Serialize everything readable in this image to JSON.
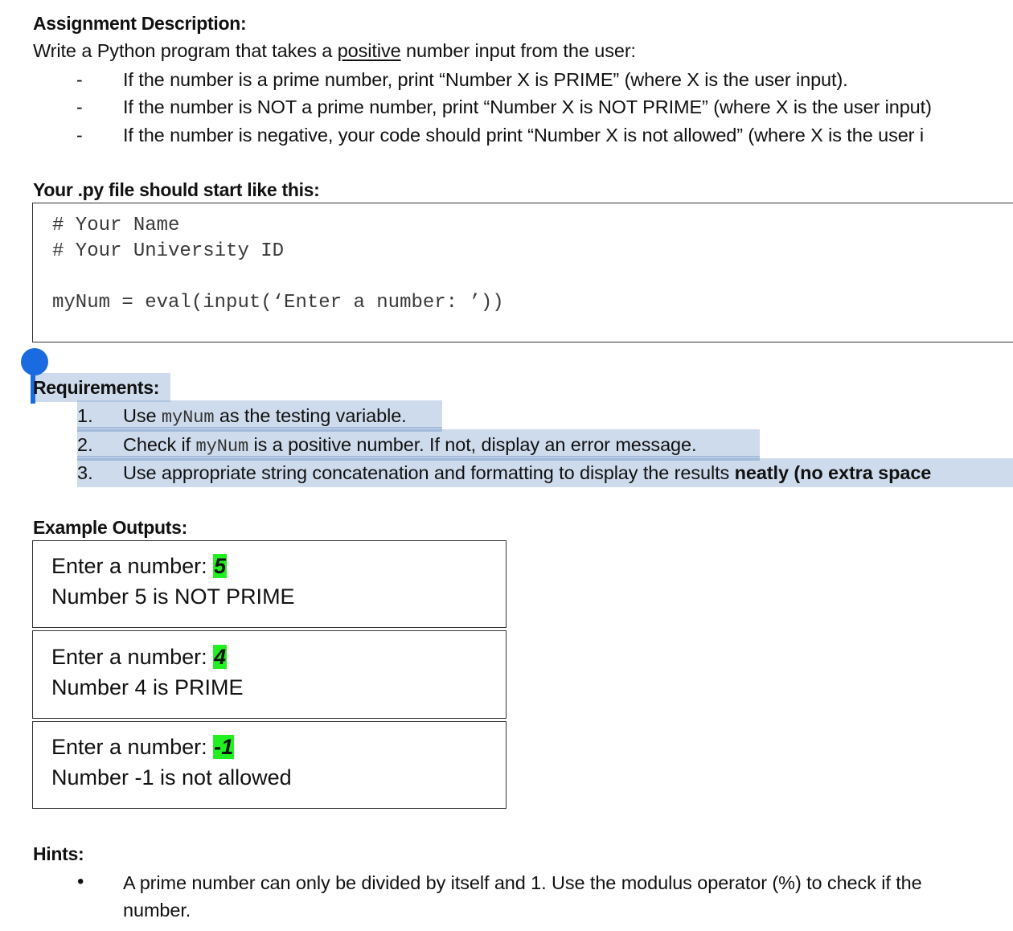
{
  "assignment": {
    "heading": "Assignment Description:",
    "intro_before": "Write a Python program that takes a ",
    "intro_underlined": "positive",
    "intro_after": " number input from the user:",
    "bullets": [
      {
        "marker": "-",
        "text": "If the number is a prime number, print “Number X is PRIME” (where X is the user input)."
      },
      {
        "marker": "-",
        "text": "If the number is NOT a prime number, print “Number X is NOT PRIME” (where X is the user input)"
      },
      {
        "marker": "-",
        "text": "If the number is negative, your code should print “Number X is not allowed” (where X is the user i"
      }
    ]
  },
  "starter": {
    "heading": "Your .py file should start like this:",
    "code_lines": [
      "# Your Name",
      "# Your University ID",
      "",
      "myNum = eval(input(‘Enter a number: ’))"
    ]
  },
  "requirements": {
    "heading": "Requirements:",
    "items": [
      {
        "num": "1.",
        "before": "Use ",
        "code": "myNum",
        "after": " as the testing variable.",
        "bold": ""
      },
      {
        "num": "2.",
        "before": "Check if ",
        "code": "myNum",
        "after": " is a positive number. If not, display an error message.",
        "bold": ""
      },
      {
        "num": "3.",
        "before": "Use appropriate string concatenation and formatting to display the results ",
        "code": "",
        "after": "",
        "bold": "neatly (no extra space"
      }
    ]
  },
  "examples": {
    "heading": "Example Outputs:",
    "highlight_color": "#22f022",
    "boxes": [
      {
        "prompt": "Enter a number: ",
        "input": "5",
        "result": "Number 5 is NOT PRIME"
      },
      {
        "prompt": "Enter a number: ",
        "input": "4",
        "result": "Number 4 is PRIME"
      },
      {
        "prompt": "Enter a number: ",
        "input": "-1",
        "result": "Number -1 is not allowed"
      }
    ]
  },
  "hints": {
    "heading": "Hints:",
    "items": [
      {
        "marker": "•",
        "line1": "A prime number can only be divided by itself and 1. Use the modulus operator (%) to check if the",
        "line2": "number."
      }
    ]
  },
  "selection_color": "#1a6be0"
}
